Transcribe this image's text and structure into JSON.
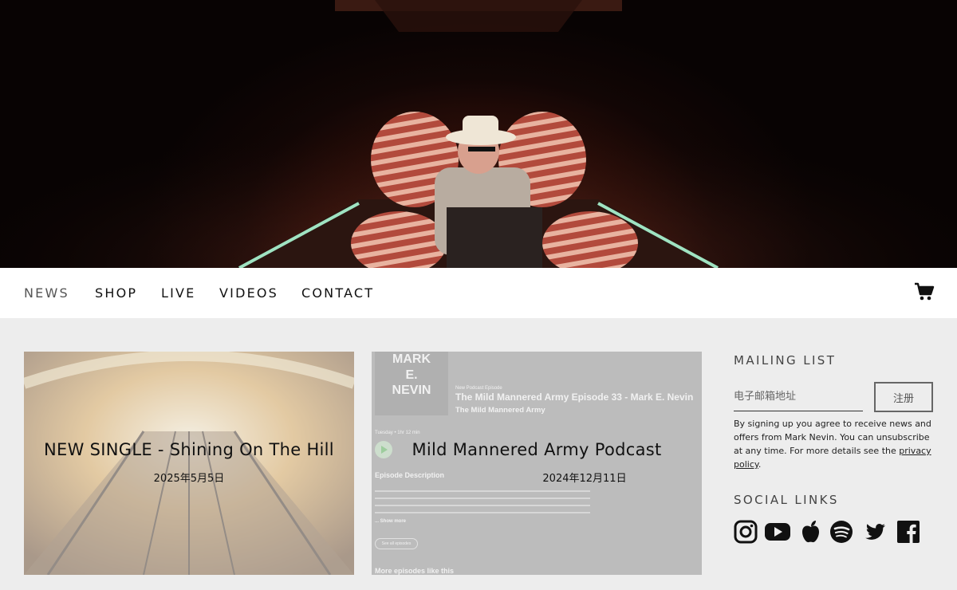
{
  "nav": {
    "items": [
      {
        "label": "NEWS",
        "active": true
      },
      {
        "label": "SHOP"
      },
      {
        "label": "LIVE"
      },
      {
        "label": "VIDEOS"
      },
      {
        "label": "CONTACT"
      }
    ],
    "cart_icon": "shopping-cart-icon"
  },
  "posts": [
    {
      "title": "NEW SINGLE - Shining On The Hill",
      "date": "2025年5月5日"
    },
    {
      "title": "Mild Mannered Army Podcast",
      "date": "2024年12月11日",
      "thumbnail": {
        "artist_lines": [
          "MARK",
          "E.",
          "NEVIN"
        ],
        "tag": "New Podcast Episode",
        "episode_title": "The Mild Mannered Army Episode 33 - Mark E. Nevin",
        "show": "The Mild Mannered Army",
        "meta": "Tuesday • 1hr 12 min",
        "description_heading": "Episode Description",
        "show_more": "... Show more",
        "see_all": "See all episodes",
        "more_episodes": "More episodes like this"
      }
    }
  ],
  "mailing_list": {
    "heading": "MAILING LIST",
    "email_placeholder": "电子邮箱地址",
    "button_label": "注册",
    "legal_text": "By signing up you agree to receive news and offers from Mark Nevin. You can unsubscribe at any time. For more details see the ",
    "privacy_link": "privacy policy",
    "legal_end": "."
  },
  "social": {
    "heading": "SOCIAL LINKS",
    "icons": [
      "instagram-icon",
      "youtube-icon",
      "apple-icon",
      "spotify-icon",
      "twitter-icon",
      "facebook-icon"
    ]
  }
}
